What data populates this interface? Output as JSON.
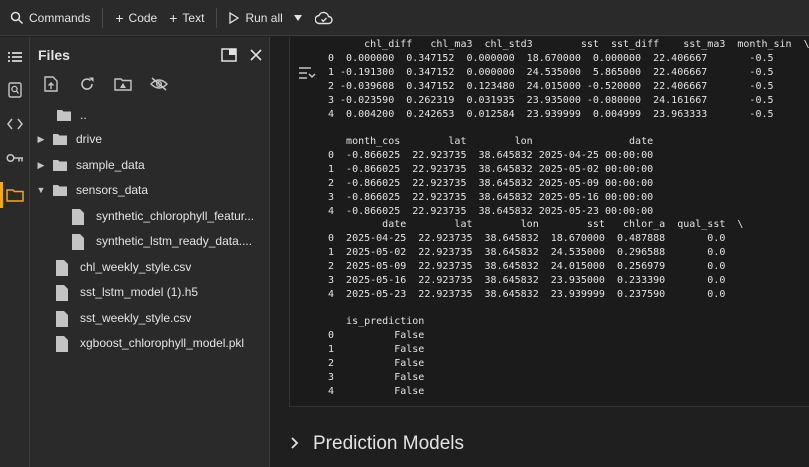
{
  "toolbar": {
    "commands": "Commands",
    "code": "Code",
    "text": "Text",
    "run_all": "Run all"
  },
  "files_panel": {
    "title": "Files",
    "tree": [
      {
        "label": "..",
        "type": "folder-open",
        "depth": 0
      },
      {
        "label": "drive",
        "type": "folder",
        "depth": 0,
        "caret": "right"
      },
      {
        "label": "sample_data",
        "type": "folder",
        "depth": 0,
        "caret": "right"
      },
      {
        "label": "sensors_data",
        "type": "folder",
        "depth": 0,
        "caret": "down"
      },
      {
        "label": "synthetic_chlorophyll_featur...",
        "type": "file",
        "depth": 1
      },
      {
        "label": "synthetic_lstm_ready_data....",
        "type": "file",
        "depth": 1
      },
      {
        "label": "chl_weekly_style.csv",
        "type": "file",
        "depth": 0
      },
      {
        "label": "sst_lstm_model (1).h5",
        "type": "file",
        "depth": 0
      },
      {
        "label": "sst_weekly_style.csv",
        "type": "file",
        "depth": 0
      },
      {
        "label": "xgboost_chlorophyll_model.pkl",
        "type": "file",
        "depth": 0
      }
    ]
  },
  "output": {
    "block1": "      chl_diff   chl_ma3  chl_std3        sst  sst_diff    sst_ma3  month_sin  \\\n0  0.000000  0.347152  0.000000  18.670000  0.000000  22.406667       -0.5\n1 -0.191300  0.347152  0.000000  24.535000  5.865000  22.406667       -0.5\n2 -0.039608  0.347152  0.123480  24.015000 -0.520000  22.406667       -0.5\n3 -0.023590  0.262319  0.031935  23.935000 -0.080000  24.161667       -0.5\n4  0.004200  0.242653  0.012584  23.939999  0.004999  23.963333       -0.5",
    "block2": "   month_cos        lat        lon                date\n0  -0.866025  22.923735  38.645832 2025-04-25 00:00:00\n1  -0.866025  22.923735  38.645832 2025-05-02 00:00:00\n2  -0.866025  22.923735  38.645832 2025-05-09 00:00:00\n3  -0.866025  22.923735  38.645832 2025-05-16 00:00:00\n4  -0.866025  22.923735  38.645832 2025-05-23 00:00:00",
    "block3": "         date        lat        lon        sst   chlor_a  qual_sst  \\\n0  2025-04-25  22.923735  38.645832  18.670000  0.487888       0.0\n1  2025-05-02  22.923735  38.645832  24.535000  0.296588       0.0\n2  2025-05-09  22.923735  38.645832  24.015000  0.256979       0.0\n3  2025-05-16  22.923735  38.645832  23.935000  0.233390       0.0\n4  2025-05-23  22.923735  38.645832  23.939999  0.237590       0.0",
    "block4": "   is_prediction\n0          False\n1          False\n2          False\n3          False\n4          False"
  },
  "section": {
    "title": "Prediction Models"
  },
  "colors": {
    "accent": "#f9ab00",
    "background": "#1f1f1f",
    "panel": "#2a2a2a"
  }
}
